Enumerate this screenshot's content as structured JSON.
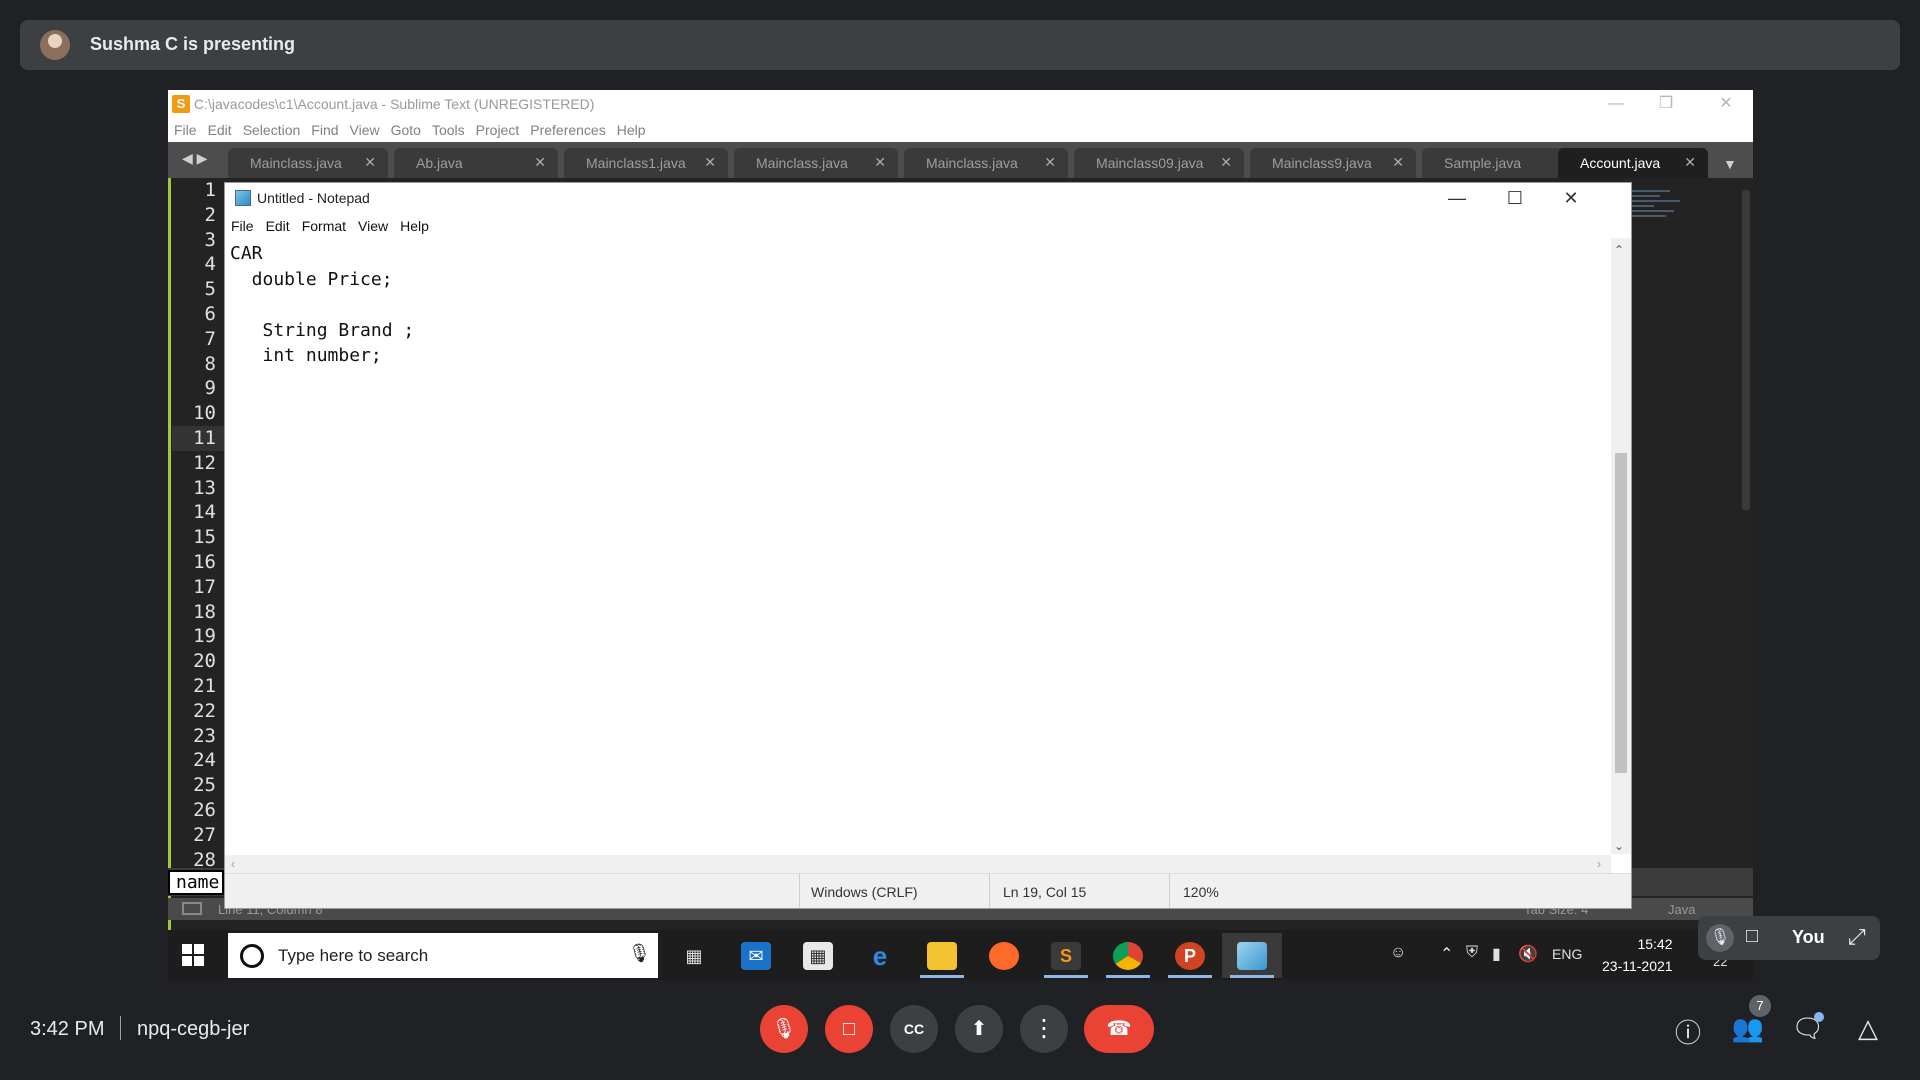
{
  "presenter": {
    "name_text": "Sushma C is presenting"
  },
  "sublime": {
    "title": "C:\\javacodes\\c1\\Account.java - Sublime Text (UNREGISTERED)",
    "menu": [
      "File",
      "Edit",
      "Selection",
      "Find",
      "View",
      "Goto",
      "Tools",
      "Project",
      "Preferences",
      "Help"
    ],
    "tabs": [
      {
        "label": "Mainclass.java"
      },
      {
        "label": "Ab.java"
      },
      {
        "label": "Mainclass1.java"
      },
      {
        "label": "Mainclass.java"
      },
      {
        "label": "Mainclass.java"
      },
      {
        "label": "Mainclass09.java"
      },
      {
        "label": "Mainclass9.java"
      },
      {
        "label": "Sample.java"
      },
      {
        "label": "Account.java"
      }
    ],
    "line_numbers": [
      "1",
      "2",
      "3",
      "4",
      "5",
      "6",
      "7",
      "8",
      "9",
      "10",
      "11",
      "12",
      "13",
      "14",
      "15",
      "16",
      "17",
      "18",
      "19",
      "20",
      "21",
      "22",
      "23",
      "24",
      "25",
      "26",
      "27",
      "28"
    ],
    "name_field": "name",
    "status_position": "Line 11, Column 8",
    "tab_size": "Tab Size: 4",
    "syntax": "Java"
  },
  "notepad": {
    "title": "Untitled - Notepad",
    "menu": [
      "File",
      "Edit",
      "Format",
      "View",
      "Help"
    ],
    "content": "CAR\n  double Price;\n\n   String Brand ;\n   int number;",
    "line_ending": "Windows (CRLF)",
    "position": "Ln 19, Col 15",
    "zoom": "120%"
  },
  "taskbar": {
    "search_placeholder": "Type here to search",
    "lang": "ENG",
    "time": "15:42",
    "date": "23-11-2021",
    "notification_count": "22"
  },
  "meet": {
    "self_label": "You",
    "time": "3:42 PM",
    "meeting_code": "npq-cegb-jer",
    "participants_count": "7"
  },
  "colors": {
    "meet_bg": "#202124",
    "meet_red": "#ea4335",
    "sublime_accent": "#9ccc34"
  }
}
